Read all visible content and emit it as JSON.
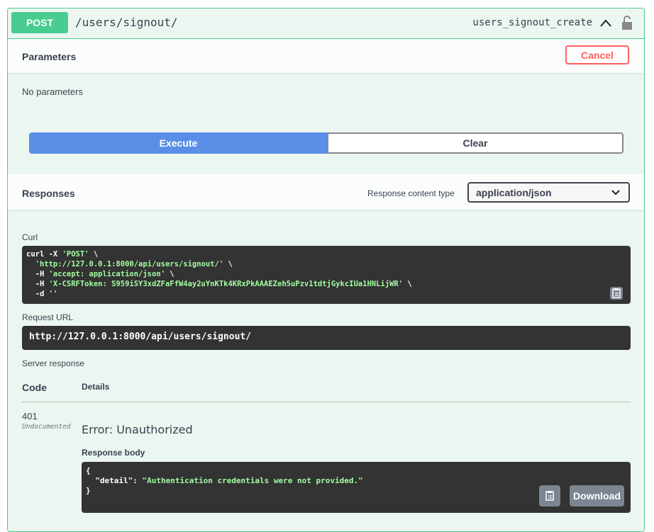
{
  "summary": {
    "method": "POST",
    "path": "/users/signout/",
    "operation_id": "users_signout_create"
  },
  "parameters": {
    "title": "Parameters",
    "cancel_label": "Cancel",
    "empty_text": "No parameters"
  },
  "actions": {
    "execute_label": "Execute",
    "clear_label": "Clear"
  },
  "responses": {
    "title": "Responses",
    "content_type_label": "Response content type",
    "content_type_value": "application/json"
  },
  "curl": {
    "label": "Curl",
    "line1_cmd": "curl -X ",
    "line1_method": "'POST'",
    "line1_end": " \\",
    "line2_url": "  'http://127.0.0.1:8000/api/users/signout/'",
    "line2_end": " \\",
    "line3_flag": "  -H ",
    "line3_val": "'accept: application/json'",
    "line3_end": " \\",
    "line4_flag": "  -H ",
    "line4_val": "'X-CSRFToken: S959iSY3xdZFaFfW4ay2uYnKTk4KRxPkAAAEZeh5uPzv1tdtjGykcIUa1HNLijWR'",
    "line4_end": " \\",
    "line5_flag": "  -d ",
    "line5_val": "''"
  },
  "request_url": {
    "label": "Request URL",
    "value": "http://127.0.0.1:8000/api/users/signout/"
  },
  "server_response": {
    "label": "Server response",
    "code_header": "Code",
    "details_header": "Details",
    "code": "401",
    "undocumented": "Undocumented",
    "error": "Error: Unauthorized",
    "body_label": "Response body",
    "body_open": "{",
    "body_key": "  \"detail\"",
    "body_sep": ": ",
    "body_val": "\"Authentication credentials were not provided.\"",
    "body_close": "}",
    "download_label": "Download"
  },
  "colors": {
    "post_green": "#49cc90",
    "execute_blue": "#5b8ee6",
    "cancel_red": "#ff6060",
    "code_bg": "#333333"
  }
}
